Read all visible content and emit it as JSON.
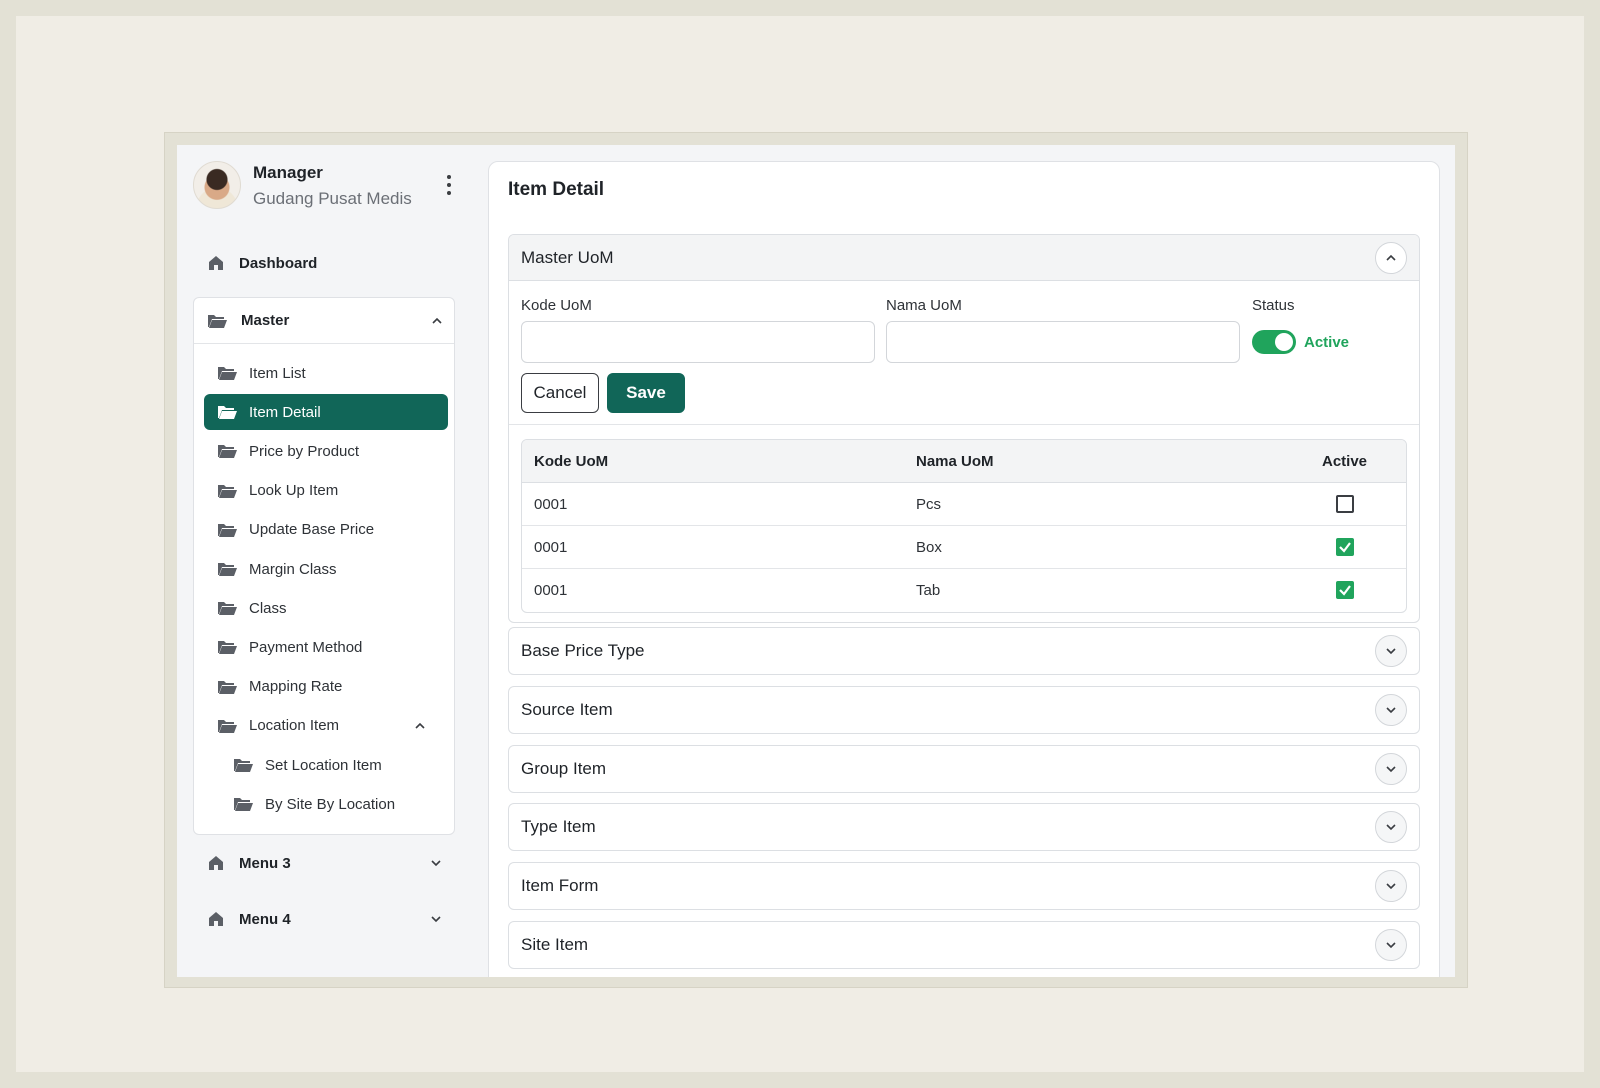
{
  "profile": {
    "name": "Manager",
    "subtitle": "Gudang Pusat Medis"
  },
  "sidebar": {
    "dashboard": "Dashboard",
    "master": "Master",
    "items": [
      {
        "label": "Item List"
      },
      {
        "label": "Item Detail",
        "active": true
      },
      {
        "label": "Price by Product"
      },
      {
        "label": "Look Up Item"
      },
      {
        "label": "Update Base Price"
      },
      {
        "label": "Margin Class"
      },
      {
        "label": "Class"
      },
      {
        "label": "Payment Method"
      },
      {
        "label": "Mapping Rate"
      },
      {
        "label": "Location Item"
      }
    ],
    "location_sub": [
      {
        "label": "Set Location Item"
      },
      {
        "label": "By Site By Location"
      }
    ],
    "menu3": "Menu 3",
    "menu4": "Menu 4"
  },
  "main": {
    "title": "Item Detail",
    "master_uom": {
      "title": "Master UoM",
      "kode_label": "Kode UoM",
      "kode_value": "",
      "nama_label": "Nama UoM",
      "nama_value": "",
      "status_label": "Status",
      "status_value": "Active",
      "cancel": "Cancel",
      "save": "Save",
      "table": {
        "headers": [
          "Kode UoM",
          "Nama UoM",
          "Active"
        ],
        "rows": [
          {
            "kode": "0001",
            "nama": "Pcs",
            "active": false
          },
          {
            "kode": "0001",
            "nama": "Box",
            "active": true
          },
          {
            "kode": "0001",
            "nama": "Tab",
            "active": true
          }
        ]
      }
    },
    "sections": [
      "Base Price Type",
      "Source Item",
      "Group Item",
      "Type Item",
      "Item Form",
      "Site Item"
    ]
  },
  "colors": {
    "accent": "#116658",
    "success": "#20a45c"
  }
}
